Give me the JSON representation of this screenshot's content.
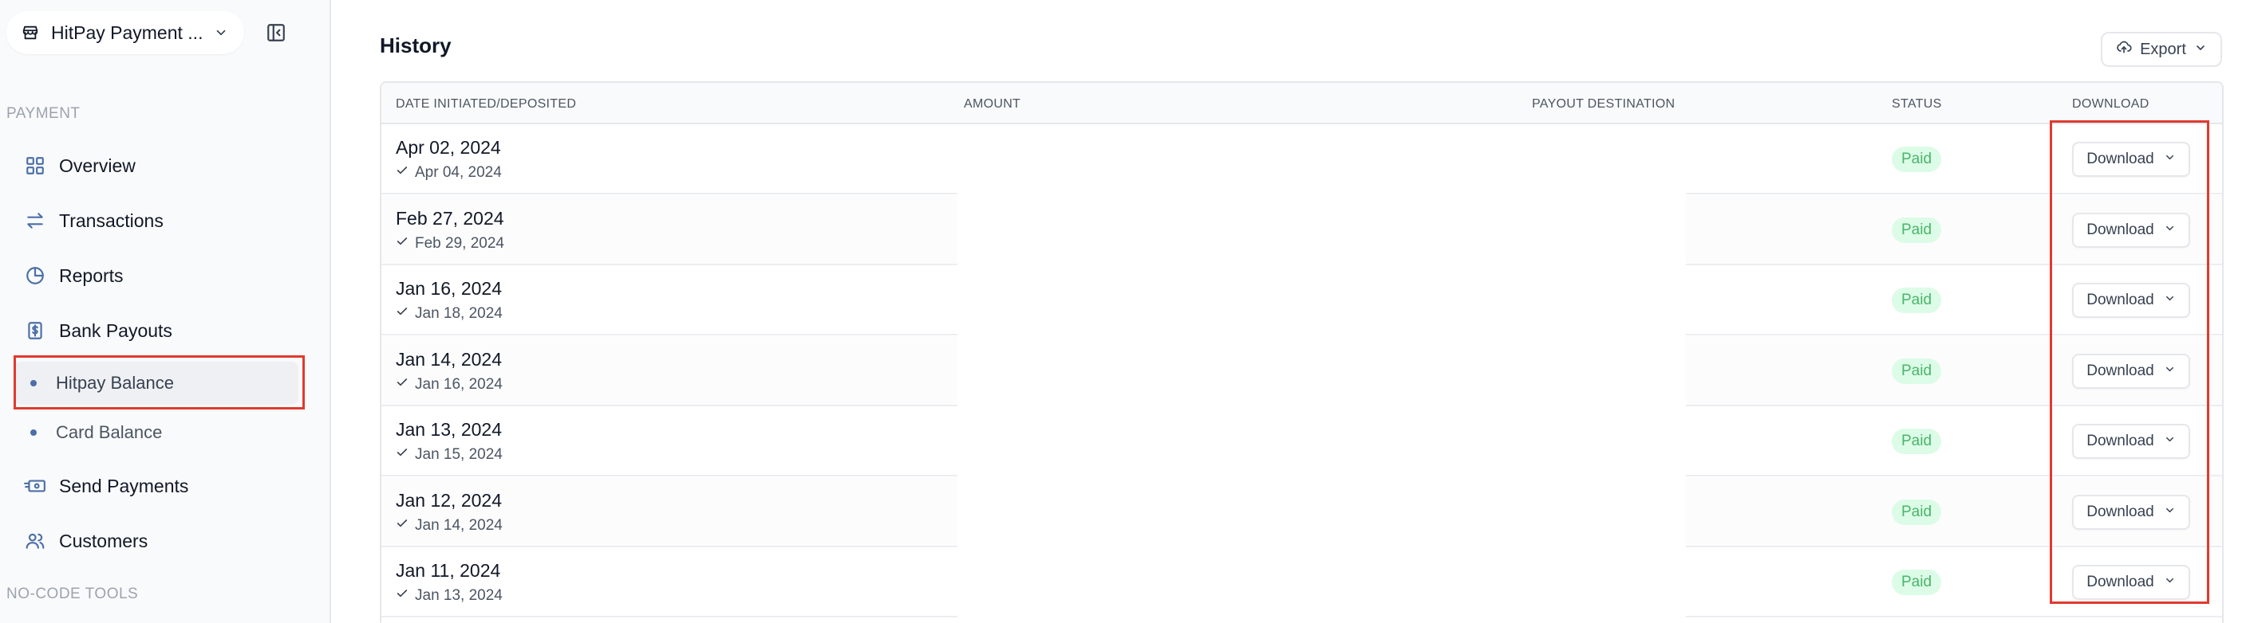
{
  "sidebar": {
    "account_name": "HitPay Payment ...",
    "sections": {
      "payment": "PAYMENT",
      "nocode": "NO-CODE TOOLS"
    },
    "items": {
      "overview": "Overview",
      "transactions": "Transactions",
      "reports": "Reports",
      "bank_payouts": "Bank Payouts",
      "hitpay_balance": "Hitpay Balance",
      "card_balance": "Card Balance",
      "send_payments": "Send Payments",
      "customers": "Customers"
    },
    "active_item": "Hitpay Balance"
  },
  "main": {
    "title": "History",
    "export_label": "Export",
    "columns": {
      "date": "DATE INITIATED/DEPOSITED",
      "amount": "AMOUNT",
      "destination": "PAYOUT DESTINATION",
      "status": "STATUS",
      "download": "DOWNLOAD"
    },
    "rows": [
      {
        "initiated": "Apr 02, 2024",
        "deposited": "Apr 04, 2024",
        "status": "Paid",
        "download": "Download"
      },
      {
        "initiated": "Feb 27, 2024",
        "deposited": "Feb 29, 2024",
        "status": "Paid",
        "download": "Download"
      },
      {
        "initiated": "Jan 16, 2024",
        "deposited": "Jan 18, 2024",
        "status": "Paid",
        "download": "Download"
      },
      {
        "initiated": "Jan 14, 2024",
        "deposited": "Jan 16, 2024",
        "status": "Paid",
        "download": "Download"
      },
      {
        "initiated": "Jan 13, 2024",
        "deposited": "Jan 15, 2024",
        "status": "Paid",
        "download": "Download"
      },
      {
        "initiated": "Jan 12, 2024",
        "deposited": "Jan 14, 2024",
        "status": "Paid",
        "download": "Download"
      },
      {
        "initiated": "Jan 11, 2024",
        "deposited": "Jan 13, 2024",
        "status": "Paid",
        "download": "Download"
      }
    ]
  },
  "colors": {
    "highlight": "#e03a2f",
    "paid_bg": "#dcfce7",
    "paid_text": "#4ab56a",
    "nav_icon": "#4b6fa8"
  }
}
